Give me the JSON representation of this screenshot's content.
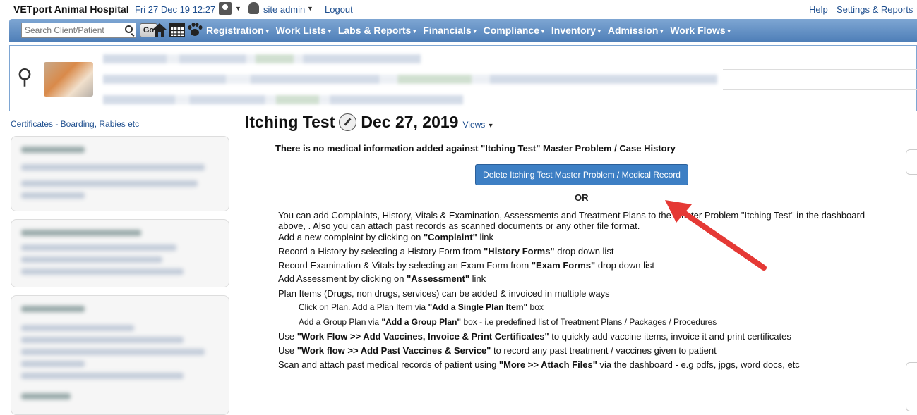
{
  "topbar": {
    "brand": "VETport Animal Hospital",
    "datetime": "Fri 27 Dec 19 12:27",
    "site_label": "site admin",
    "logout": "Logout",
    "help": "Help",
    "settings": "Settings & Reports"
  },
  "navbar": {
    "search_placeholder": "Search Client/Patient",
    "go_label": "Go",
    "menu": [
      {
        "label": "Registration"
      },
      {
        "label": "Work Lists"
      },
      {
        "label": "Labs & Reports"
      },
      {
        "label": "Financials"
      },
      {
        "label": "Compliance"
      },
      {
        "label": "Inventory"
      },
      {
        "label": "Admission"
      },
      {
        "label": "Work Flows"
      }
    ]
  },
  "patient": {
    "gender_symbol": "⚲"
  },
  "sidebar": {
    "cert_link": "Certificates - Boarding, Rabies etc"
  },
  "main": {
    "title": "Itching Test",
    "date": "Dec 27, 2019",
    "views": "Views",
    "info": "There is no medical information added against \"Itching Test\" Master Problem / Case History",
    "delete_button": "Delete Itching Test Master Problem / Medical Record",
    "or": "OR",
    "lines": [
      {
        "pre": "You can add Complaints, History, Vitals & Examination, Assessments and Treatment Plans to the Master Problem \"Itching Test\" in the dashboard",
        "b": "",
        "post": ""
      },
      {
        "pre": "above, . Also you can attach past records as scanned documents or any other file format.",
        "b": "",
        "post": ""
      },
      {
        "pre": "Add a new complaint by clicking on ",
        "b": "\"Complaint\"",
        "post": " link"
      },
      {
        "pre": "Record a History by selecting a History Form from ",
        "b": "\"History Forms\"",
        "post": " drop down list"
      },
      {
        "pre": "Record Examination & Vitals by selecting an Exam Form from ",
        "b": "\"Exam Forms\"",
        "post": " drop down list"
      },
      {
        "pre": "Add Assessment by clicking on ",
        "b": "\"Assessment\"",
        "post": " link"
      },
      {
        "pre": "Plan Items (Drugs, non drugs, services) can be added & invoiced in multiple ways",
        "b": "",
        "post": ""
      },
      {
        "pre": "Click on Plan. Add a Plan Item via ",
        "b": "\"Add a Single Plan Item\"",
        "post": " box"
      },
      {
        "pre": "Add a Group Plan via ",
        "b": "\"Add a Group Plan\"",
        "post": " box - i.e predefined list of Treatment Plans / Packages / Procedures"
      },
      {
        "pre": "Use ",
        "b": "\"Work Flow >> Add Vaccines, Invoice & Print Certificates\"",
        "post": " to quickly add vaccine items, invoice it and print certificates"
      },
      {
        "pre": "Use ",
        "b": "\"Work flow >> Add Past Vaccines & Service\"",
        "post": " to record any past treatment / vaccines given to patient"
      },
      {
        "pre": "Scan and attach past medical records of patient using ",
        "b": "\"More >> Attach Files\"",
        "post": " via the dashboard - e.g pdfs, jpgs, word docs, etc"
      }
    ]
  },
  "colors": {
    "nav_top": "#7ea6d3",
    "nav_bottom": "#4f7fb8",
    "link": "#1f4f8f",
    "button": "#3d7fc4",
    "arrow": "#e53935"
  }
}
